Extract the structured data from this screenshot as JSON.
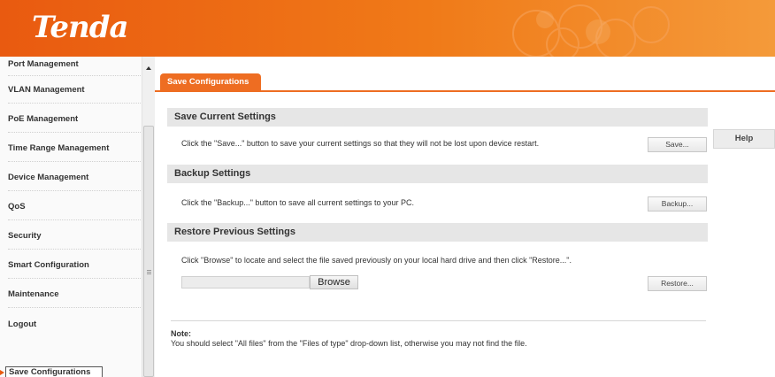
{
  "brand": {
    "logo": "Tenda"
  },
  "sidebar": {
    "items": [
      {
        "label": "Port Management"
      },
      {
        "label": "VLAN Management"
      },
      {
        "label": "PoE Management"
      },
      {
        "label": "Time Range Management"
      },
      {
        "label": "Device Management"
      },
      {
        "label": "QoS"
      },
      {
        "label": "Security"
      },
      {
        "label": "Smart Configuration"
      },
      {
        "label": "Maintenance"
      },
      {
        "label": "Logout"
      }
    ],
    "active_item": "Save Configurations"
  },
  "tab": {
    "label": "Save Configurations"
  },
  "save_section": {
    "title": "Save Current Settings",
    "description": "Click the \"Save...\" button to save your current settings so that they will not be lost upon device restart.",
    "button": "Save..."
  },
  "help": {
    "label": "Help"
  },
  "backup_section": {
    "title": "Backup Settings",
    "description": "Click the \"Backup...\" button to save all current settings to your PC.",
    "button": "Backup..."
  },
  "restore_section": {
    "title": "Restore Previous Settings",
    "description": "Click \"Browse\" to locate and select the file saved previously on your local hard drive and then click \"Restore...\".",
    "file_value": "",
    "browse_button": "Browse",
    "button": "Restore..."
  },
  "note": {
    "title": "Note:",
    "text": "You should select \"All files\" from the \"Files of type\" drop-down list, otherwise you may not find the file."
  },
  "colors": {
    "accent": "#ee6d22",
    "banner": "#e95a10",
    "section_header_bg": "#e6e6e6"
  }
}
